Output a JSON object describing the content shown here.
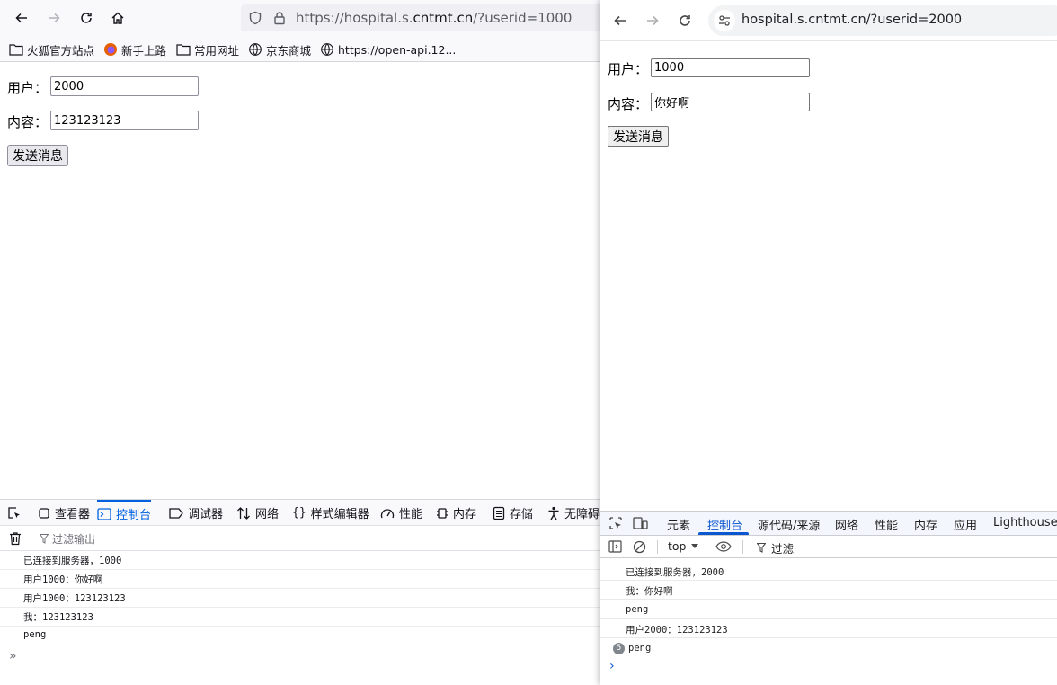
{
  "left": {
    "url": {
      "prefix": "https://hospital.s.",
      "domain": "cntmt.cn",
      "suffix": "/?userid=1000"
    },
    "bookmarks": [
      "火狐官方站点",
      "新手上路",
      "常用网址",
      "京东商城",
      "https://open-api.12..."
    ],
    "form": {
      "user_label": "用户：",
      "user_value": "2000",
      "content_label": "内容：",
      "content_value": "123123123",
      "send_label": "发送消息"
    },
    "devtools": {
      "tabs": [
        "查看器",
        "控制台",
        "调试器",
        "网络",
        "样式编辑器",
        "性能",
        "内存",
        "存储",
        "无障碍"
      ],
      "active_tab": "控制台",
      "filter_placeholder": "过滤输出",
      "logs": [
        "已连接到服务器，1000",
        "用户1000：你好啊",
        "用户1000：123123123",
        "我：123123123",
        "peng"
      ],
      "prompt": "»"
    }
  },
  "right": {
    "url": "hospital.s.cntmt.cn/?userid=2000",
    "form": {
      "user_label": "用户：",
      "user_value": "1000",
      "content_label": "内容：",
      "content_value": "你好啊",
      "send_label": "发送消息"
    },
    "devtools": {
      "tabs": [
        "元素",
        "控制台",
        "源代码/来源",
        "网络",
        "性能",
        "内存",
        "应用",
        "Lighthouse"
      ],
      "active_tab": "控制台",
      "context": "top",
      "filter_placeholder": "过滤",
      "logs": [
        "已连接到服务器，2000",
        "我：你好啊",
        "peng",
        "用户2000：123123123"
      ],
      "grouped_log": {
        "count": "5",
        "text": "peng"
      },
      "prompt": "›"
    }
  },
  "colors": {
    "firefox_accent": "#0061e0",
    "chrome_accent": "#0b57d0"
  }
}
